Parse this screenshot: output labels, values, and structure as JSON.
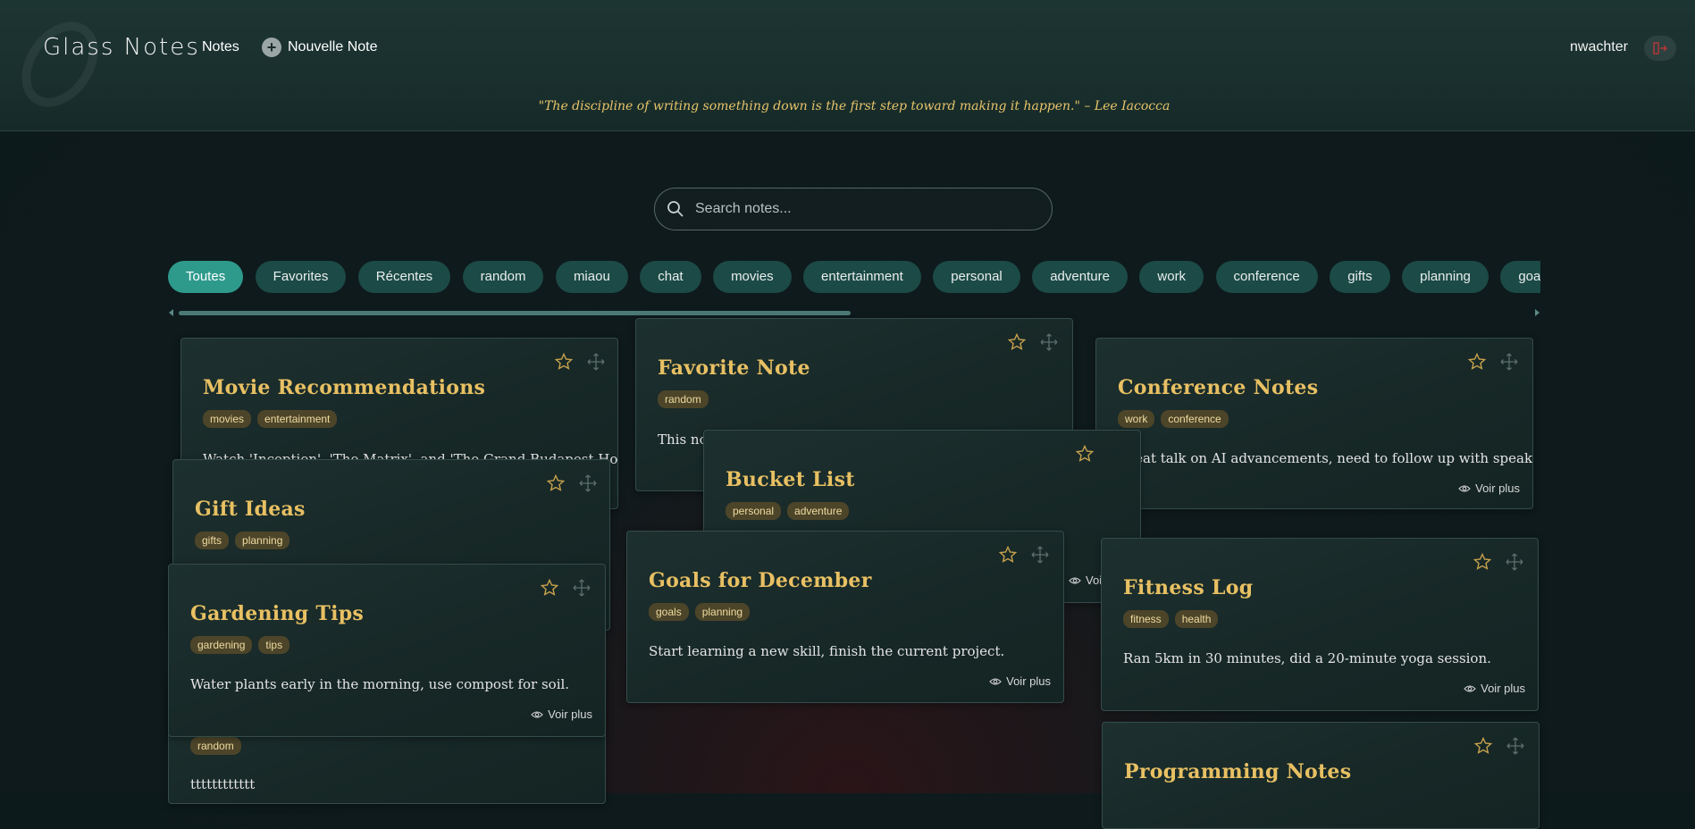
{
  "header": {
    "logo": "Glass Notes",
    "nav_notes": "Notes",
    "nav_new": "Nouvelle Note",
    "username": "nwachter",
    "quote": "\"The discipline of writing something down is the first step toward making it happen.\" – Lee Iacocca"
  },
  "search": {
    "placeholder": "Search notes..."
  },
  "filters": [
    "Toutes",
    "Favorites",
    "Récentes",
    "random",
    "miaou",
    "chat",
    "movies",
    "entertainment",
    "personal",
    "adventure",
    "work",
    "conference",
    "gifts",
    "planning",
    "goals"
  ],
  "active_filter": "Toutes",
  "colors": {
    "accent": "#2e9a8c",
    "title_gold": "#e8c063",
    "chip_bg": "#1c4a46",
    "tag_bg": "#4d4529"
  },
  "cards": {
    "movie": {
      "title": "Movie Recommendations",
      "tags": [
        "movies",
        "entertainment"
      ],
      "body": "Watch 'Inception', 'The Matrix', and 'The Grand Budapest Hotel'"
    },
    "favorite": {
      "title": "Favorite Note",
      "tags": [
        "random"
      ],
      "body": "This not"
    },
    "conference": {
      "title": "Conference Notes",
      "tags": [
        "work",
        "conference"
      ],
      "body": "Great talk on AI advancements, need to follow up with speaker.",
      "more": "Voir plus"
    },
    "gift": {
      "title": "Gift Ideas",
      "tags": [
        "gifts",
        "planning"
      ]
    },
    "bucket": {
      "title": "Bucket List",
      "tags": [
        "personal",
        "adventure"
      ],
      "more": "Voir"
    },
    "goals": {
      "title": "Goals for December",
      "tags": [
        "goals",
        "planning"
      ],
      "body": "Start learning a new skill, finish the current project.",
      "more": "Voir plus"
    },
    "fitness": {
      "title": "Fitness Log",
      "tags": [
        "fitness",
        "health"
      ],
      "body": "Ran 5km in 30 minutes, did a 20-minute yoga session.",
      "more": "Voir plus"
    },
    "gardening": {
      "title": "Gardening Tips",
      "tags": [
        "gardening",
        "tips"
      ],
      "body": "Water plants early in the morning, use compost for soil.",
      "more": "Voir plus"
    },
    "random_note": {
      "tags": [
        "random"
      ],
      "body": "tttttttttttt"
    },
    "programming": {
      "title": "Programming Notes"
    }
  }
}
